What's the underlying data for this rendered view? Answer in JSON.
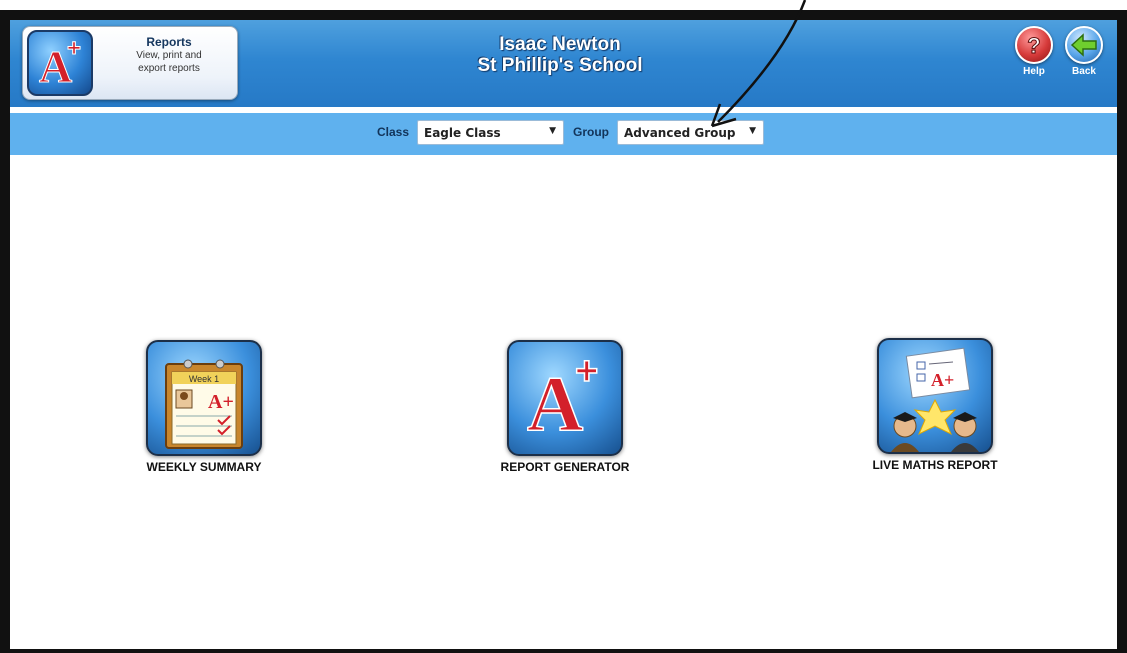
{
  "header": {
    "reports_card": {
      "title": "Reports",
      "subtitle_line1": "View, print and",
      "subtitle_line2": "export reports",
      "icon": "a-plus-icon"
    },
    "student_name": "Isaac Newton",
    "school_name": "St Phillip's School",
    "help_label": "Help",
    "back_label": "Back"
  },
  "filters": {
    "class_label": "Class",
    "class_value": "Eagle Class",
    "group_label": "Group",
    "group_value": "Advanced Group"
  },
  "tiles": [
    {
      "label": "WEEKLY SUMMARY",
      "icon": "weekly-calendar-icon",
      "calendar_text": "Week 1"
    },
    {
      "label": "REPORT GENERATOR",
      "icon": "a-plus-icon"
    },
    {
      "label": "LIVE MATHS REPORT",
      "icon": "graduates-report-icon"
    }
  ],
  "colors": {
    "header_blue": "#2f86d1",
    "filter_bar": "#5fb1ee",
    "grade_red": "#d3202a"
  }
}
